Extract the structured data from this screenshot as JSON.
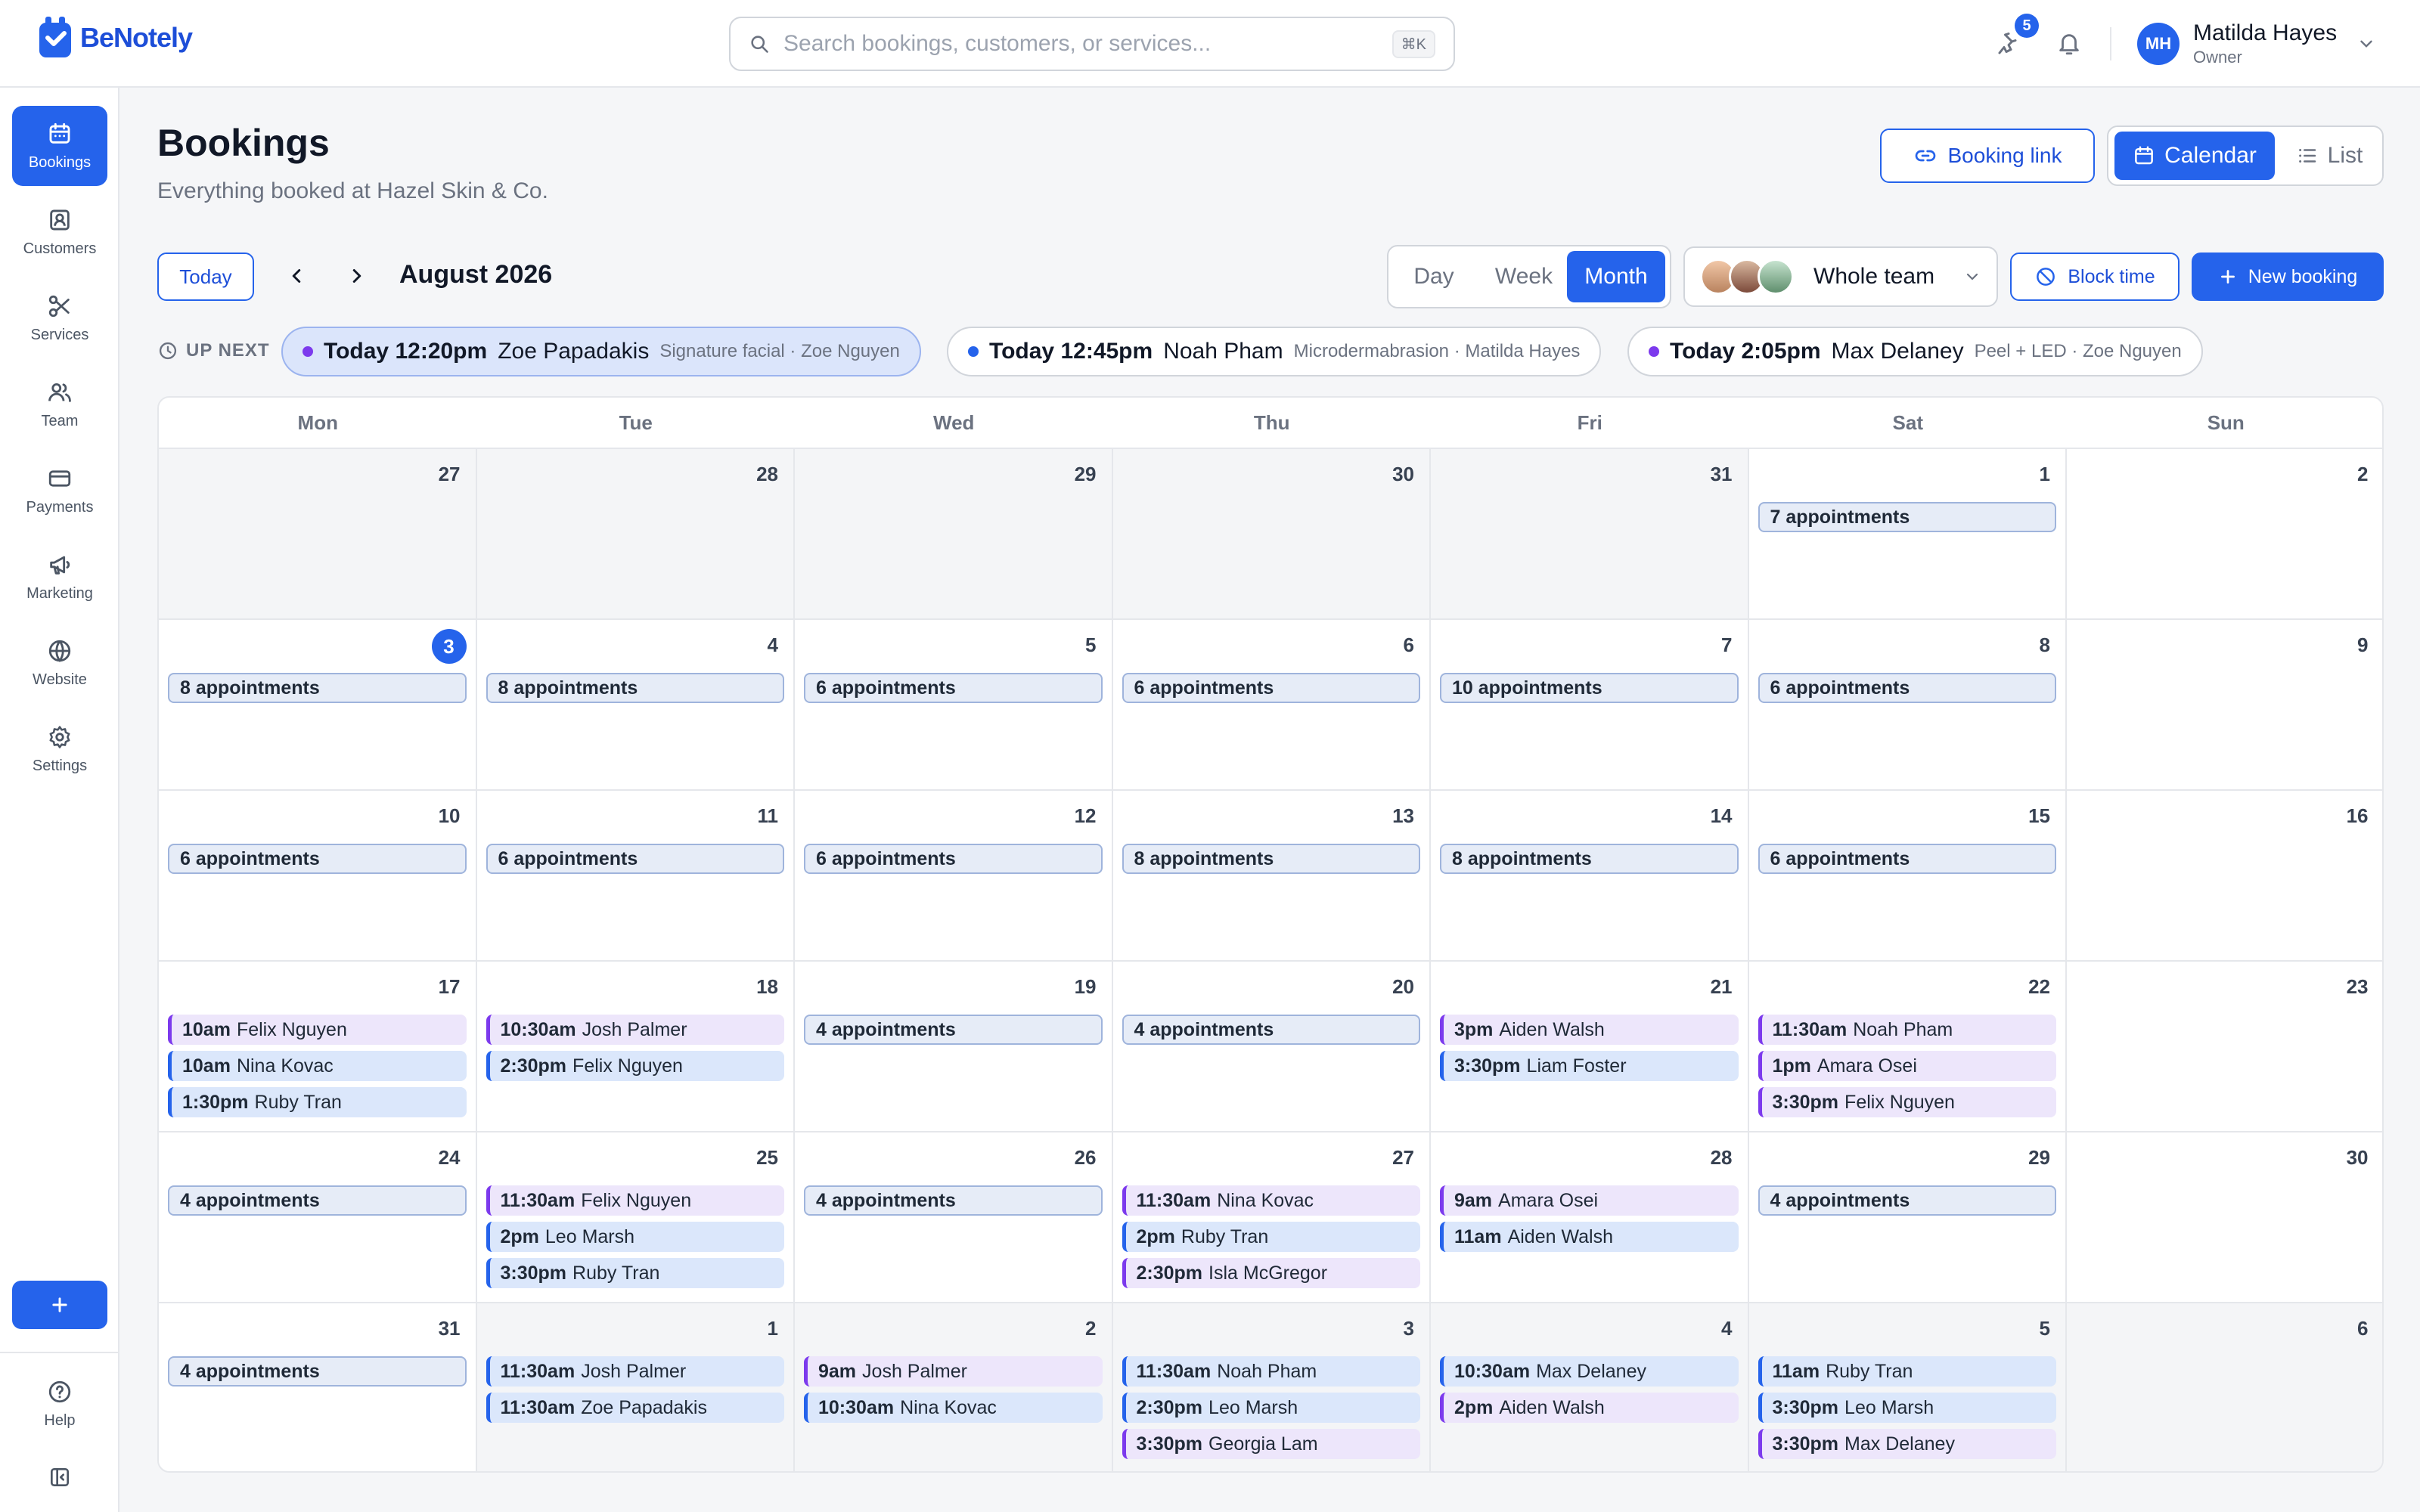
{
  "app": {
    "name": "BeNotely"
  },
  "search": {
    "placeholder": "Search bookings, customers, or services...",
    "shortcut": "⌘K"
  },
  "topbar": {
    "notification_count": "5"
  },
  "user": {
    "initials": "MH",
    "name": "Matilda Hayes",
    "role": "Owner"
  },
  "sidebar": {
    "items": [
      {
        "label": "Bookings",
        "icon": "calendar-icon"
      },
      {
        "label": "Customers",
        "icon": "contact-icon"
      },
      {
        "label": "Services",
        "icon": "scissors-icon"
      },
      {
        "label": "Team",
        "icon": "users-icon"
      },
      {
        "label": "Payments",
        "icon": "credit-card-icon"
      },
      {
        "label": "Marketing",
        "icon": "megaphone-icon"
      },
      {
        "label": "Website",
        "icon": "globe-icon"
      },
      {
        "label": "Settings",
        "icon": "gear-icon"
      }
    ],
    "help_label": "Help"
  },
  "header": {
    "title": "Bookings",
    "subtitle": "Everything booked at Hazel Skin & Co.",
    "booking_link_label": "Booking link",
    "view_toggle": {
      "calendar": "Calendar",
      "list": "List"
    }
  },
  "toolbar": {
    "today_label": "Today",
    "month_label": "August 2026",
    "range": {
      "day": "Day",
      "week": "Week",
      "month": "Month"
    },
    "team_label": "Whole team",
    "block_time_label": "Block time",
    "new_booking_label": "New booking"
  },
  "up_next": {
    "label": "UP NEXT",
    "items": [
      {
        "time": "Today 12:20pm",
        "name": "Zoe Papadakis",
        "meta": "Signature facial · Zoe Nguyen",
        "color": "#7c3aed"
      },
      {
        "time": "Today 12:45pm",
        "name": "Noah Pham",
        "meta": "Microdermabrasion · Matilda Hayes",
        "color": "#2563eb"
      },
      {
        "time": "Today 2:05pm",
        "name": "Max Delaney",
        "meta": "Peel + LED · Zoe Nguyen",
        "color": "#7c3aed"
      }
    ]
  },
  "calendar": {
    "weekdays": [
      "Mon",
      "Tue",
      "Wed",
      "Thu",
      "Fri",
      "Sat",
      "Sun"
    ],
    "weeks": [
      [
        {
          "day": "27",
          "muted": true,
          "events": []
        },
        {
          "day": "28",
          "muted": true,
          "events": []
        },
        {
          "day": "29",
          "muted": true,
          "events": []
        },
        {
          "day": "30",
          "muted": true,
          "events": []
        },
        {
          "day": "31",
          "muted": true,
          "events": []
        },
        {
          "day": "1",
          "events": [
            {
              "count": "7 appointments"
            }
          ]
        },
        {
          "day": "2",
          "events": []
        }
      ],
      [
        {
          "day": "3",
          "today": true,
          "events": [
            {
              "count": "8 appointments"
            }
          ]
        },
        {
          "day": "4",
          "events": [
            {
              "count": "8 appointments"
            }
          ]
        },
        {
          "day": "5",
          "events": [
            {
              "count": "6 appointments"
            }
          ]
        },
        {
          "day": "6",
          "events": [
            {
              "count": "6 appointments"
            }
          ]
        },
        {
          "day": "7",
          "events": [
            {
              "count": "10 appointments"
            }
          ]
        },
        {
          "day": "8",
          "events": [
            {
              "count": "6 appointments"
            }
          ]
        },
        {
          "day": "9",
          "events": []
        }
      ],
      [
        {
          "day": "10",
          "events": [
            {
              "count": "6 appointments"
            }
          ]
        },
        {
          "day": "11",
          "events": [
            {
              "count": "6 appointments"
            }
          ]
        },
        {
          "day": "12",
          "events": [
            {
              "count": "6 appointments"
            }
          ]
        },
        {
          "day": "13",
          "events": [
            {
              "count": "8 appointments"
            }
          ]
        },
        {
          "day": "14",
          "events": [
            {
              "count": "8 appointments"
            }
          ]
        },
        {
          "day": "15",
          "events": [
            {
              "count": "6 appointments"
            }
          ]
        },
        {
          "day": "16",
          "events": []
        }
      ],
      [
        {
          "day": "17",
          "events": [
            {
              "time": "10am",
              "name": "Felix Nguyen",
              "color": "purple"
            },
            {
              "time": "10am",
              "name": "Nina Kovac",
              "color": "blue"
            },
            {
              "time": "1:30pm",
              "name": "Ruby Tran",
              "color": "blue"
            }
          ]
        },
        {
          "day": "18",
          "events": [
            {
              "time": "10:30am",
              "name": "Josh Palmer",
              "color": "purple"
            },
            {
              "time": "2:30pm",
              "name": "Felix Nguyen",
              "color": "blue"
            }
          ]
        },
        {
          "day": "19",
          "events": [
            {
              "count": "4 appointments"
            }
          ]
        },
        {
          "day": "20",
          "events": [
            {
              "count": "4 appointments"
            }
          ]
        },
        {
          "day": "21",
          "events": [
            {
              "time": "3pm",
              "name": "Aiden Walsh",
              "color": "purple"
            },
            {
              "time": "3:30pm",
              "name": "Liam Foster",
              "color": "blue"
            }
          ]
        },
        {
          "day": "22",
          "events": [
            {
              "time": "11:30am",
              "name": "Noah Pham",
              "color": "purple"
            },
            {
              "time": "1pm",
              "name": "Amara Osei",
              "color": "purple"
            },
            {
              "time": "3:30pm",
              "name": "Felix Nguyen",
              "color": "purple"
            }
          ]
        },
        {
          "day": "23",
          "events": []
        }
      ],
      [
        {
          "day": "24",
          "events": [
            {
              "count": "4 appointments"
            }
          ]
        },
        {
          "day": "25",
          "events": [
            {
              "time": "11:30am",
              "name": "Felix Nguyen",
              "color": "purple"
            },
            {
              "time": "2pm",
              "name": "Leo Marsh",
              "color": "blue"
            },
            {
              "time": "3:30pm",
              "name": "Ruby Tran",
              "color": "blue"
            }
          ]
        },
        {
          "day": "26",
          "events": [
            {
              "count": "4 appointments"
            }
          ]
        },
        {
          "day": "27",
          "events": [
            {
              "time": "11:30am",
              "name": "Nina Kovac",
              "color": "purple"
            },
            {
              "time": "2pm",
              "name": "Ruby Tran",
              "color": "blue"
            },
            {
              "time": "2:30pm",
              "name": "Isla McGregor",
              "color": "purple"
            }
          ]
        },
        {
          "day": "28",
          "events": [
            {
              "time": "9am",
              "name": "Amara Osei",
              "color": "purple"
            },
            {
              "time": "11am",
              "name": "Aiden Walsh",
              "color": "blue"
            }
          ]
        },
        {
          "day": "29",
          "events": [
            {
              "count": "4 appointments"
            }
          ]
        },
        {
          "day": "30",
          "events": []
        }
      ],
      [
        {
          "day": "31",
          "events": [
            {
              "count": "4 appointments"
            }
          ]
        },
        {
          "day": "1",
          "muted": true,
          "events": [
            {
              "time": "11:30am",
              "name": "Josh Palmer",
              "color": "blue"
            },
            {
              "time": "11:30am",
              "name": "Zoe Papadakis",
              "color": "blue"
            }
          ]
        },
        {
          "day": "2",
          "muted": true,
          "events": [
            {
              "time": "9am",
              "name": "Josh Palmer",
              "color": "purple"
            },
            {
              "time": "10:30am",
              "name": "Nina Kovac",
              "color": "blue"
            }
          ]
        },
        {
          "day": "3",
          "muted": true,
          "events": [
            {
              "time": "11:30am",
              "name": "Noah Pham",
              "color": "blue"
            },
            {
              "time": "2:30pm",
              "name": "Leo Marsh",
              "color": "blue"
            },
            {
              "time": "3:30pm",
              "name": "Georgia Lam",
              "color": "purple"
            }
          ]
        },
        {
          "day": "4",
          "muted": true,
          "events": [
            {
              "time": "10:30am",
              "name": "Max Delaney",
              "color": "blue"
            },
            {
              "time": "2pm",
              "name": "Aiden Walsh",
              "color": "purple"
            }
          ]
        },
        {
          "day": "5",
          "muted": true,
          "events": [
            {
              "time": "11am",
              "name": "Ruby Tran",
              "color": "blue"
            },
            {
              "time": "3:30pm",
              "name": "Leo Marsh",
              "color": "blue"
            },
            {
              "time": "3:30pm",
              "name": "Max Delaney",
              "color": "purple"
            }
          ]
        },
        {
          "day": "6",
          "muted": true,
          "events": []
        }
      ]
    ]
  }
}
